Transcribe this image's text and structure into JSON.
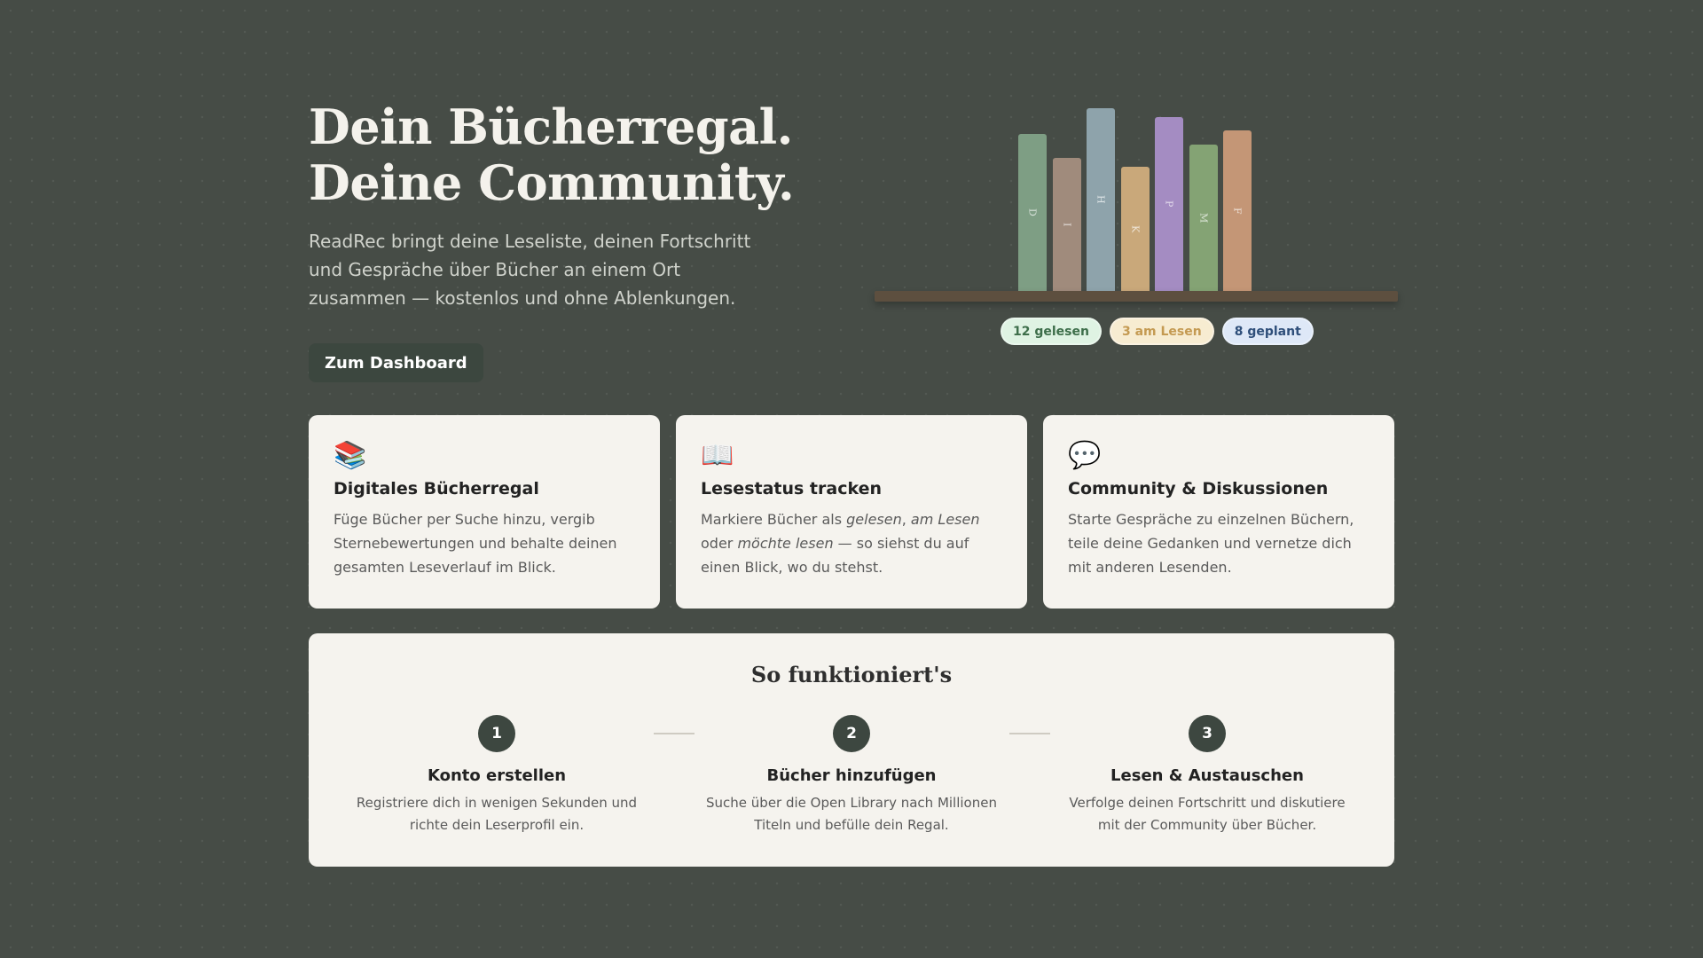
{
  "hero": {
    "title_line1": "Dein Bücherregal.",
    "title_line2": "Deine Community.",
    "subtitle": "ReadRec bringt deine Leseliste, deinen Fortschritt und Gespräche über Bücher an einem Ort zusammen — kostenlos und ohne Ablenkungen.",
    "cta_label": "Zum Dashboard"
  },
  "shelf": {
    "books": [
      {
        "letter": "D",
        "color": "#7e9e84",
        "height_pct": 0.86
      },
      {
        "letter": "I",
        "color": "#a08b7c",
        "height_pct": 0.73
      },
      {
        "letter": "H",
        "color": "#8ea3ab",
        "height_pct": 1.0
      },
      {
        "letter": "K",
        "color": "#c9a87a",
        "height_pct": 0.68
      },
      {
        "letter": "P",
        "color": "#a48cc2",
        "height_pct": 0.95
      },
      {
        "letter": "M",
        "color": "#84a374",
        "height_pct": 0.8
      },
      {
        "letter": "F",
        "color": "#c49676",
        "height_pct": 0.88
      }
    ],
    "board_color": "#5d4f3f"
  },
  "badges": {
    "read": "12 gelesen",
    "current": "3 am Lesen",
    "planned": "8 geplant"
  },
  "features": [
    {
      "icon": "📚",
      "title": "Digitales Bücherregal",
      "text": "Füge Bücher per Suche hinzu, vergib Sternebewertungen und behalte deinen gesamten Leseverlauf im Blick."
    },
    {
      "icon": "📖",
      "title": "Lesestatus tracken",
      "text_prefix": "Markiere Bücher als ",
      "text_em1": "gelesen",
      "text_sep": ", ",
      "text_em2": "am Lesen",
      "text_mid": " oder ",
      "text_em3": "möchte lesen",
      "text_suffix": " — so siehst du auf einen Blick, wo du stehst."
    },
    {
      "icon": "💬",
      "title": "Community & Diskussionen",
      "text": "Starte Gespräche zu einzelnen Büchern, teile deine Gedanken und vernetze dich mit anderen Lesenden."
    }
  ],
  "how": {
    "title": "So funktioniert's",
    "steps": [
      {
        "num": "1",
        "title": "Konto erstellen",
        "text": "Registriere dich in wenigen Sekunden und richte dein Leserprofil ein."
      },
      {
        "num": "2",
        "title": "Bücher hinzufügen",
        "text": "Suche über die Open Library nach Millionen Titeln und befülle dein Regal."
      },
      {
        "num": "3",
        "title": "Lesen & Austauschen",
        "text": "Verfolge deinen Fortschritt und diskutiere mit der Community über Bücher."
      }
    ]
  }
}
